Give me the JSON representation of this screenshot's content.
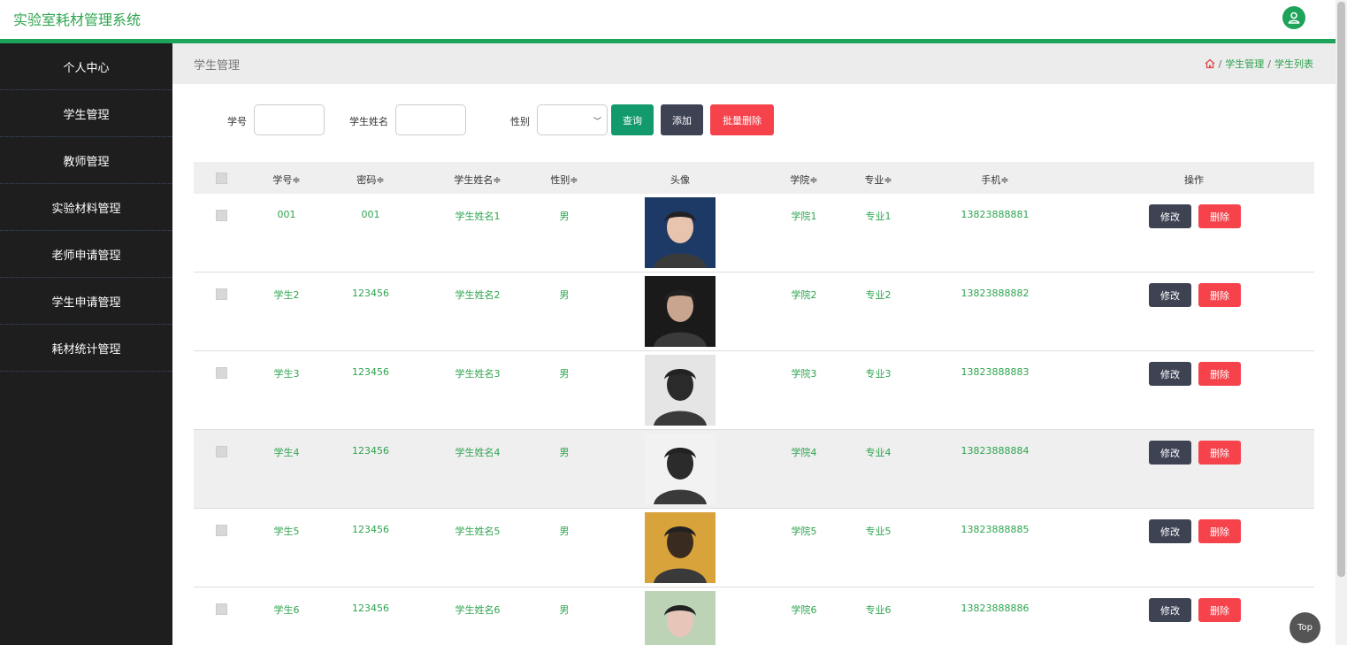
{
  "app": {
    "title": "实验室耗材管理系统"
  },
  "sidebar": {
    "items": [
      {
        "label": "个人中心"
      },
      {
        "label": "学生管理"
      },
      {
        "label": "教师管理"
      },
      {
        "label": "实验材料管理"
      },
      {
        "label": "老师申请管理"
      },
      {
        "label": "学生申请管理"
      },
      {
        "label": "耗材统计管理"
      }
    ]
  },
  "header": {
    "section_title": "学生管理",
    "breadcrumb": [
      "学生管理",
      "学生列表"
    ]
  },
  "search": {
    "student_no_label": "学号",
    "student_no_value": "",
    "name_label": "学生姓名",
    "name_value": "",
    "gender_label": "性别",
    "gender_value": "",
    "query_label": "查询",
    "add_label": "添加",
    "batch_delete_label": "批量删除"
  },
  "table": {
    "columns": [
      "学号≑",
      "密码≑",
      "学生姓名≑",
      "性别≑",
      "头像",
      "学院≑",
      "专业≑",
      "手机≑",
      "操作"
    ],
    "edit_label": "修改",
    "delete_label": "删除",
    "rows": [
      {
        "no": "001",
        "password": "001",
        "name": "学生姓名1",
        "gender": "男",
        "college": "学院1",
        "major": "专业1",
        "phone": "13823888881",
        "avatar_colors": [
          "#1d3a66",
          "#e8c3ae"
        ]
      },
      {
        "no": "学生2",
        "password": "123456",
        "name": "学生姓名2",
        "gender": "男",
        "college": "学院2",
        "major": "专业2",
        "phone": "13823888882",
        "avatar_colors": [
          "#1a1a1a",
          "#c9a58f"
        ]
      },
      {
        "no": "学生3",
        "password": "123456",
        "name": "学生姓名3",
        "gender": "男",
        "college": "学院3",
        "major": "专业3",
        "phone": "13823888883",
        "avatar_colors": [
          "#e5e5e5",
          "#2a2a2a"
        ]
      },
      {
        "no": "学生4",
        "password": "123456",
        "name": "学生姓名4",
        "gender": "男",
        "college": "学院4",
        "major": "专业4",
        "phone": "13823888884",
        "avatar_colors": [
          "#f2f2f2",
          "#2b2b2b"
        ]
      },
      {
        "no": "学生5",
        "password": "123456",
        "name": "学生姓名5",
        "gender": "男",
        "college": "学院5",
        "major": "专业5",
        "phone": "13823888885",
        "avatar_colors": [
          "#d9a33b",
          "#3a2b20"
        ]
      },
      {
        "no": "学生6",
        "password": "123456",
        "name": "学生姓名6",
        "gender": "男",
        "college": "学院6",
        "major": "专业6",
        "phone": "13823888886",
        "avatar_colors": [
          "#bcd3b6",
          "#e7c6b9"
        ]
      }
    ]
  },
  "footer": {
    "top_label": "Top"
  }
}
